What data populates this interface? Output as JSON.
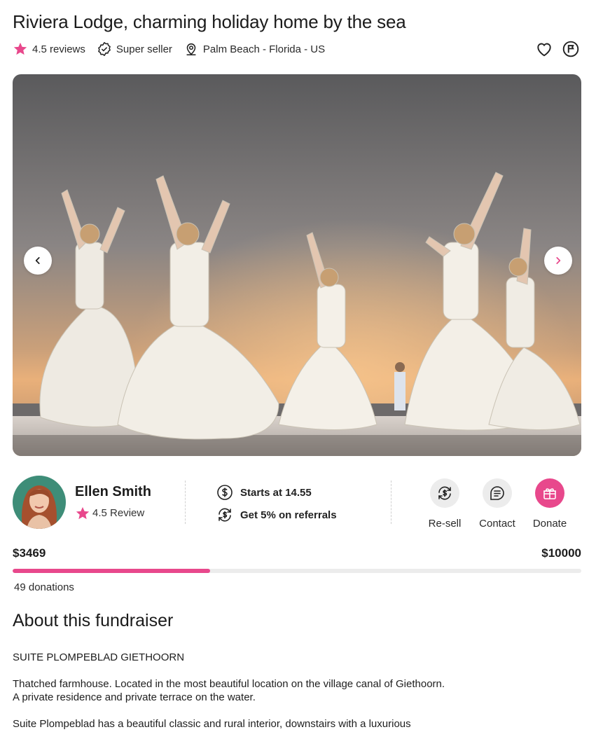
{
  "listing": {
    "title": "Riviera Lodge, charming holiday home by the sea",
    "rating_text": "4.5 reviews",
    "seller_badge": "Super seller",
    "location": "Palm Beach - Florida - US"
  },
  "icons": {
    "rating": "star-icon",
    "seller": "verified-badge-icon",
    "location": "map-pin-icon",
    "favorite": "heart-icon",
    "report": "flag-icon",
    "prev": "chevron-left-icon",
    "next": "chevron-right-icon",
    "price": "dollar-circle-icon",
    "referral": "exchange-dollar-icon",
    "resell": "exchange-dollar-icon",
    "contact": "chat-icon",
    "donate": "gift-icon"
  },
  "host": {
    "name": "Ellen Smith",
    "rating_text": "4.5 Review"
  },
  "perks": {
    "price": "Starts at 14.55",
    "referral": "Get 5% on referrals"
  },
  "actions": {
    "resell": "Re-sell",
    "contact": "Contact",
    "donate": "Donate"
  },
  "fundraising": {
    "raised": "$3469",
    "goal": "$10000",
    "progress_percent": 34.69,
    "donations": "49 donations"
  },
  "about": {
    "title": "About this fundraiser",
    "paragraph1": "SUITE PLOMPEBLAD GIETHOORN",
    "paragraph2_line1": "Thatched farmhouse. Located in the most beautiful location on the village canal of Giethoorn.",
    "paragraph2_line2": "A private residence and private terrace on the water.",
    "paragraph3": "Suite Plompeblad has a beautiful classic and rural interior, downstairs with a luxurious"
  },
  "colors": {
    "accent": "#e8488c",
    "star": "#e8488c",
    "track": "#ececec"
  }
}
